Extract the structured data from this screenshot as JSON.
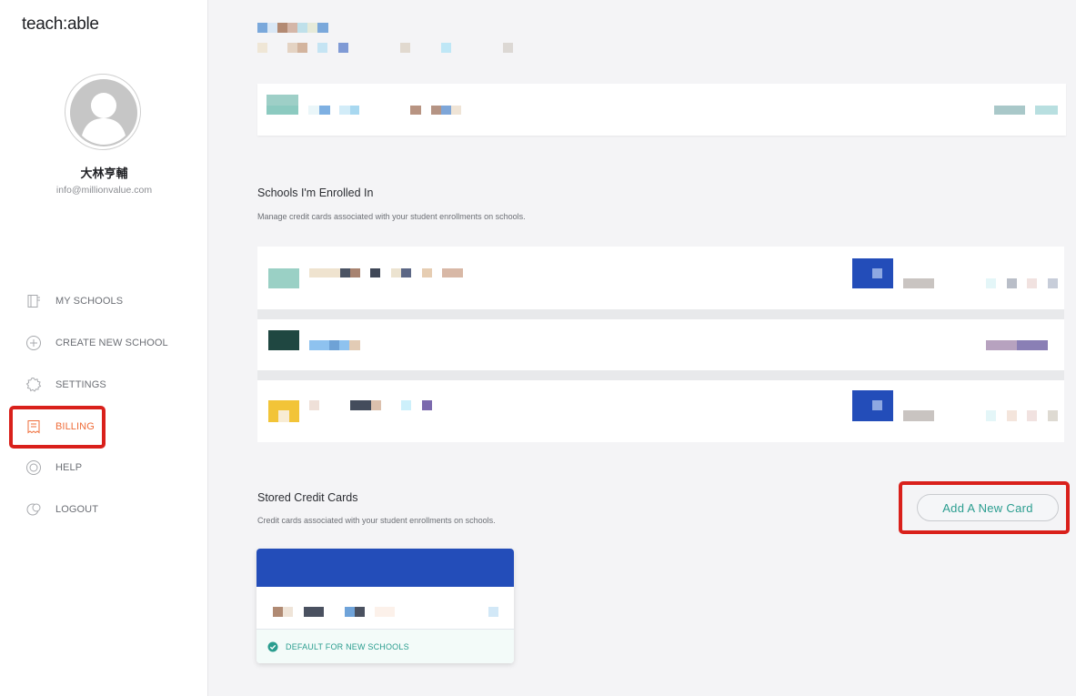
{
  "app": {
    "logo": "teach:able"
  },
  "user": {
    "name": "大林亨輔",
    "email": "info@millionvalue.com"
  },
  "nav": {
    "items": [
      {
        "label": "MY SCHOOLS",
        "icon": "schools-icon",
        "active": false
      },
      {
        "label": "CREATE NEW SCHOOL",
        "icon": "plus-circle-icon",
        "active": false
      },
      {
        "label": "SETTINGS",
        "icon": "gear-icon",
        "active": false
      },
      {
        "label": "BILLING",
        "icon": "receipt-icon",
        "active": true
      },
      {
        "label": "HELP",
        "icon": "help-ring-icon",
        "active": false
      },
      {
        "label": "LOGOUT",
        "icon": "logout-icon",
        "active": false
      }
    ]
  },
  "enrolled": {
    "title": "Schools I'm Enrolled In",
    "subtitle": "Manage credit cards associated with your student enrollments on schools."
  },
  "stored_cards": {
    "title": "Stored Credit Cards",
    "subtitle": "Credit cards associated with your student enrollments on schools.",
    "add_button": "Add A New Card",
    "default_label": "DEFAULT FOR NEW SCHOOLS"
  },
  "colors": {
    "accent_orange": "#ef6d3a",
    "accent_teal": "#2a9d8f",
    "card_blue": "#234db9",
    "highlight_red": "#d9201b"
  }
}
